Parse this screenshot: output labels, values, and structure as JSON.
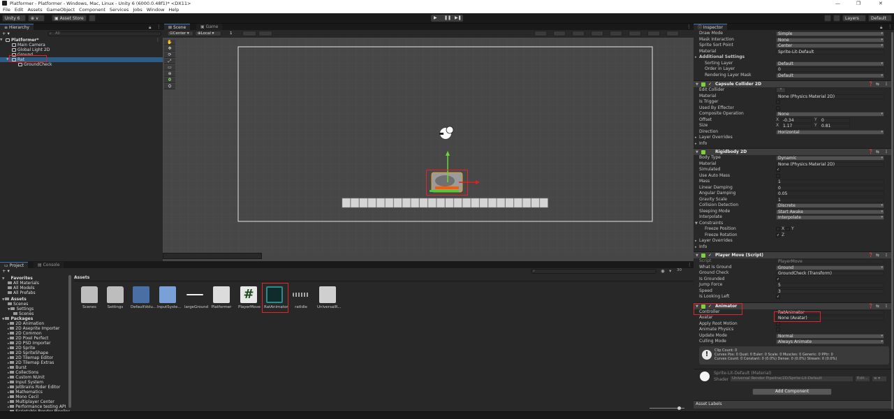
{
  "window": {
    "title": "Platformer - Platformer - Windows, Mac, Linux - Unity 6 (6000.0.48f1)* <DX11>",
    "controls": [
      "—",
      "❐",
      "✕"
    ]
  },
  "menu": [
    "File",
    "Edit",
    "Assets",
    "GameObject",
    "Component",
    "Services",
    "Jobs",
    "Window",
    "Help"
  ],
  "toolbar": {
    "account": "Unity 6",
    "cloud_glyph": "⊕ ∨",
    "asset_store": "Asset Store",
    "asset_store_chevron": "▾",
    "layers": "Layers",
    "layout": "Default"
  },
  "hierarchy": {
    "tab": "Hierarchy",
    "search_placeholder": "All",
    "add_glyph": "+ ▾",
    "rows": [
      {
        "label": "Platformer*",
        "indent": 0,
        "bold": true,
        "arrow": "▼"
      },
      {
        "label": "Main Camera",
        "indent": 1
      },
      {
        "label": "Global Light 2D",
        "indent": 1
      },
      {
        "label": "Ground",
        "indent": 1
      },
      {
        "label": "Rat",
        "indent": 1,
        "selected": true,
        "arrow": "▼"
      },
      {
        "label": "GroundCheck",
        "indent": 2
      }
    ]
  },
  "scene": {
    "tabs": [
      "Scene",
      "Game"
    ],
    "pivot": "Center",
    "space": "Local",
    "snap_value": "1",
    "tools": [
      "✋",
      "✥",
      "⟳",
      "⤢",
      "▭",
      "⊕",
      "0",
      "⛭"
    ]
  },
  "project": {
    "tabs": [
      "Project",
      "Console"
    ],
    "breadcrumb": "Assets",
    "zoom_value": "30",
    "favorites_label": "Favorites",
    "favorites": [
      "All Materials",
      "All Models",
      "All Prefabs"
    ],
    "assets_label": "Assets",
    "assets_tree": [
      "Scenes",
      "Settings",
      "Scenes"
    ],
    "packages_label": "Packages",
    "packages": [
      "2D Animation",
      "2D Aseprite Importer",
      "2D Common",
      "2D Pixel Perfect",
      "2D PSD Importer",
      "2D Sprite",
      "2D SpriteShape",
      "2D Tilemap Editor",
      "2D Tilemap Extras",
      "Burst",
      "Collections",
      "Custom NUnit",
      "Input System",
      "JetBrains Rider Editor",
      "Mathematics",
      "Mono Cecil",
      "Multiplayer Center",
      "Performance testing API",
      "Scriptable Render Pipeline"
    ],
    "items": [
      {
        "label": "Scenes",
        "icon": "folder-icon"
      },
      {
        "label": "Settings",
        "icon": "folder-icon"
      },
      {
        "label": "DefaultVolu...",
        "icon": "volume-profile-icon"
      },
      {
        "label": "InputSyste...",
        "icon": "input-actions-icon"
      },
      {
        "label": "largeGround",
        "icon": "sprite-icon"
      },
      {
        "label": "Platformer",
        "icon": "unity-scene-icon"
      },
      {
        "label": "PlayerMove",
        "icon": "script-icon"
      },
      {
        "label": "RatAnimator",
        "icon": "animator-controller-icon",
        "highlighted": true
      },
      {
        "label": "ratIdle",
        "icon": "animation-clip-icon"
      },
      {
        "label": "UniversalR...",
        "icon": "render-pipeline-icon"
      }
    ]
  },
  "inspector": {
    "tab": "Inspector",
    "sprite_rows": [
      {
        "label": "Draw Mode",
        "value": "Simple",
        "type": "drop"
      },
      {
        "label": "Mask Interaction",
        "value": "None",
        "type": "drop"
      },
      {
        "label": "Sprite Sort Point",
        "value": "Center",
        "type": "drop"
      },
      {
        "label": "Material",
        "value": "Sprite-Lit-Default",
        "type": "field"
      }
    ],
    "additional_settings": "Additional Settings",
    "additional_rows": [
      {
        "label": "Sorting Layer",
        "value": "Default",
        "type": "drop"
      },
      {
        "label": "Order in Layer",
        "value": "0",
        "type": "field"
      },
      {
        "label": "Rendering Layer Mask",
        "value": "Default",
        "type": "drop"
      }
    ],
    "capsule": {
      "title": "Capsule Collider 2D",
      "rows": [
        {
          "label": "Edit Collider",
          "value": "",
          "type": "editbtn"
        },
        {
          "label": "Material",
          "value": "None (Physics Material 2D)",
          "type": "field"
        },
        {
          "label": "Is Trigger",
          "value": "",
          "type": "check"
        },
        {
          "label": "Used By Effector",
          "value": "",
          "type": "check"
        },
        {
          "label": "Composite Operation",
          "value": "None",
          "type": "drop"
        },
        {
          "label": "Offset",
          "value": "",
          "type": "vec"
        },
        {
          "label": "Size",
          "value": "",
          "type": "vec"
        },
        {
          "label": "Direction",
          "value": "Horizontal",
          "type": "drop"
        }
      ],
      "offset": {
        "x": "-0.34",
        "y": "0"
      },
      "size": {
        "x": "1.17",
        "y": "0.81"
      },
      "layer_overrides": "Layer Overrides",
      "info": "Info"
    },
    "rigidbody": {
      "title": "Rigidbody 2D",
      "rows": [
        {
          "label": "Body Type",
          "value": "Dynamic",
          "type": "drop"
        },
        {
          "label": "Material",
          "value": "None (Physics Material 2D)",
          "type": "field"
        },
        {
          "label": "Simulated",
          "value": "✓",
          "type": "check"
        },
        {
          "label": "Use Auto Mass",
          "value": "",
          "type": "check"
        },
        {
          "label": "Mass",
          "value": "1",
          "type": "field"
        },
        {
          "label": "Linear Damping",
          "value": "0",
          "type": "field"
        },
        {
          "label": "Angular Damping",
          "value": "0.05",
          "type": "field"
        },
        {
          "label": "Gravity Scale",
          "value": "1",
          "type": "field"
        },
        {
          "label": "Collision Detection",
          "value": "Discrete",
          "type": "drop"
        },
        {
          "label": "Sleeping Mode",
          "value": "Start Awake",
          "type": "drop"
        },
        {
          "label": "Interpolate",
          "value": "Interpolate",
          "type": "drop"
        }
      ],
      "constraints": "Constraints",
      "freeze_position": "Freeze Position",
      "freeze_rotation": "Freeze Rotation",
      "x_label": "X",
      "y_label": "Y",
      "z_label": "Z",
      "layer_overrides": "Layer Overrides",
      "info": "Info"
    },
    "player_move": {
      "title": "Player Move (Script)",
      "rows": [
        {
          "label": "Script",
          "value": "PlayerMove",
          "type": "field"
        },
        {
          "label": "What Is Ground",
          "value": "Ground",
          "type": "drop"
        },
        {
          "label": "Ground Check",
          "value": "GroundCheck (Transform)",
          "type": "field"
        },
        {
          "label": "Is Grounded",
          "value": "✓",
          "type": "check"
        },
        {
          "label": "Jump Force",
          "value": "5",
          "type": "field"
        },
        {
          "label": "Speed",
          "value": "3",
          "type": "field"
        },
        {
          "label": "Is Looking Left",
          "value": "✓",
          "type": "check"
        }
      ]
    },
    "animator": {
      "title": "Animator",
      "rows": [
        {
          "label": "Controller",
          "value": "RatAnimator",
          "type": "field"
        },
        {
          "label": "Avatar",
          "value": "None (Avatar)",
          "type": "field"
        },
        {
          "label": "Apply Root Motion",
          "value": "",
          "type": "check"
        },
        {
          "label": "Animate Physics",
          "value": "",
          "type": "check"
        },
        {
          "label": "Update Mode",
          "value": "Normal",
          "type": "drop"
        },
        {
          "label": "Culling Mode",
          "value": "Always Animate",
          "type": "drop"
        }
      ],
      "info_lines": [
        "Clip Count: 0",
        "Curves Pos: 0 Quat: 0 Euler: 0 Scale: 0 Muscles: 0 Generic: 0 PPtr: 0",
        "Curves Count: 0 Constant: 0 (0.0%) Dense: 0 (0.0%) Stream: 0 (0.0%)"
      ]
    },
    "material": {
      "name": "Sprite-Lit-Default (Material)",
      "shader_label": "Shader",
      "shader": "Universal Render Pipeline/2D/Sprite-Lit-Default",
      "edit": "Edit...",
      "menu": "≡ ▾"
    },
    "add_component": "Add Component",
    "asset_labels": "Asset Labels"
  },
  "colors": {
    "highlight": "#e0262b",
    "selection": "#2c5d87",
    "accent": "#3a79bb"
  }
}
